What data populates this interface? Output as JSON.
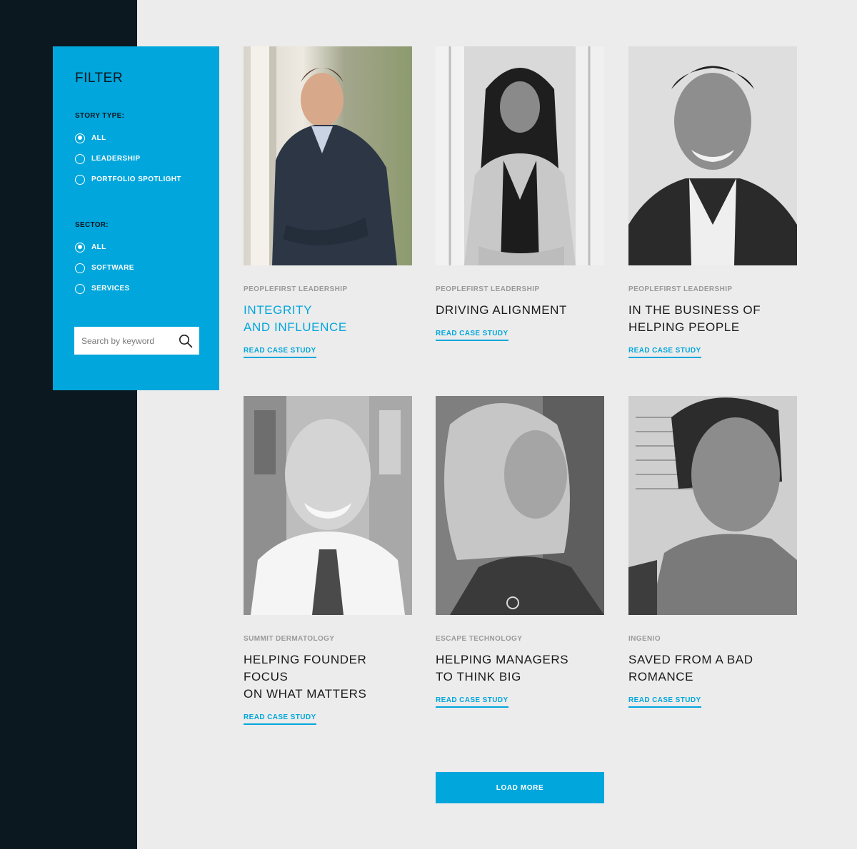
{
  "filter": {
    "title": "FILTER",
    "story_type": {
      "label": "STORY TYPE:",
      "options": [
        {
          "label": "ALL",
          "checked": true
        },
        {
          "label": "LEADERSHIP",
          "checked": false
        },
        {
          "label": "PORTFOLIO SPOTLIGHT",
          "checked": false
        }
      ]
    },
    "sector": {
      "label": "SECTOR:",
      "options": [
        {
          "label": "ALL",
          "checked": true
        },
        {
          "label": "SOFTWARE",
          "checked": false
        },
        {
          "label": "SERVICES",
          "checked": false
        }
      ]
    },
    "search": {
      "placeholder": "Search by keyword",
      "value": ""
    }
  },
  "cards": [
    {
      "category": "PEOPLEFIRST LEADERSHIP",
      "title": "INTEGRITY\nAND INFLUENCE",
      "link": "READ CASE STUDY",
      "highlighted": true
    },
    {
      "category": "PEOPLEFIRST LEADERSHIP",
      "title": "DRIVING ALIGNMENT",
      "link": "READ CASE STUDY",
      "highlighted": false
    },
    {
      "category": "PEOPLEFIRST LEADERSHIP",
      "title": "IN THE BUSINESS OF\nHELPING PEOPLE",
      "link": "READ CASE STUDY",
      "highlighted": false
    },
    {
      "category": "SUMMIT DERMATOLOGY",
      "title": "HELPING FOUNDER FOCUS\nON WHAT MATTERS",
      "link": "READ CASE STUDY",
      "highlighted": false
    },
    {
      "category": "ESCAPE TECHNOLOGY",
      "title": "HELPING MANAGERS\nTO THINK BIG",
      "link": "READ CASE STUDY",
      "highlighted": false
    },
    {
      "category": "INGENIO",
      "title": "SAVED FROM A BAD\nROMANCE",
      "link": "READ CASE STUDY",
      "highlighted": false
    }
  ],
  "load_more": "LOAD MORE",
  "colors": {
    "accent": "#00a6dc",
    "sidebar_dark": "#0c1820",
    "background": "#ececec"
  }
}
